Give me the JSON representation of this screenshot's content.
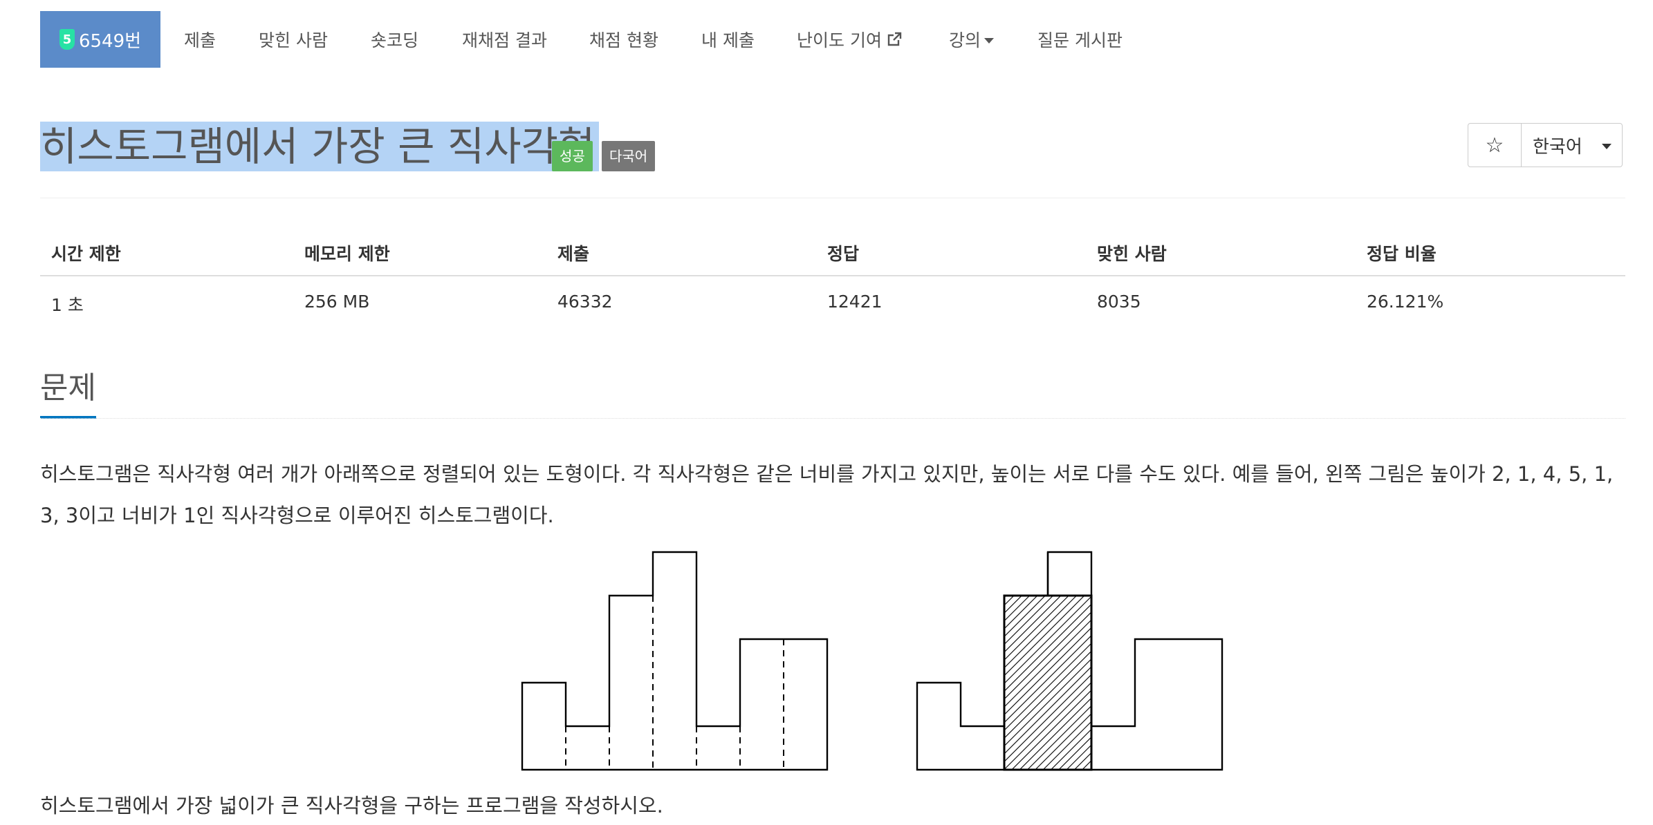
{
  "nav": {
    "problem_number": "6549번",
    "tier": "5",
    "items": [
      "제출",
      "맞힌 사람",
      "숏코딩",
      "재채점 결과",
      "채점 현황",
      "내 제출",
      "난이도 기여",
      "강의",
      "질문 게시판"
    ]
  },
  "problem": {
    "title": "히스토그램에서 가장 큰 직사각형",
    "labels": {
      "status": "성공",
      "language": "다국어"
    },
    "star": "☆",
    "language_select": "한국어"
  },
  "info": {
    "headers": [
      "시간 제한",
      "메모리 제한",
      "제출",
      "정답",
      "맞힌 사람",
      "정답 비율"
    ],
    "values": [
      "1 초",
      "256 MB",
      "46332",
      "12421",
      "8035",
      "26.121%"
    ]
  },
  "section": {
    "title": "문제",
    "description": "히스토그램은 직사각형 여러 개가 아래쪽으로 정렬되어 있는 도형이다. 각 직사각형은 같은 너비를 가지고 있지만, 높이는 서로 다를 수도 있다. 예를 들어, 왼쪽 그림은 높이가 2, 1, 4, 5, 1, 3, 3이고 너비가 1인 직사각형으로 이루어진 히스토그램이다.",
    "task": "히스토그램에서 가장 넓이가 큰 직사각형을 구하는 프로그램을 작성하시오."
  },
  "figure": {
    "heights": [
      2,
      1,
      4,
      5,
      1,
      3,
      3
    ],
    "largest": {
      "start": 2,
      "end": 3,
      "height": 4
    }
  }
}
